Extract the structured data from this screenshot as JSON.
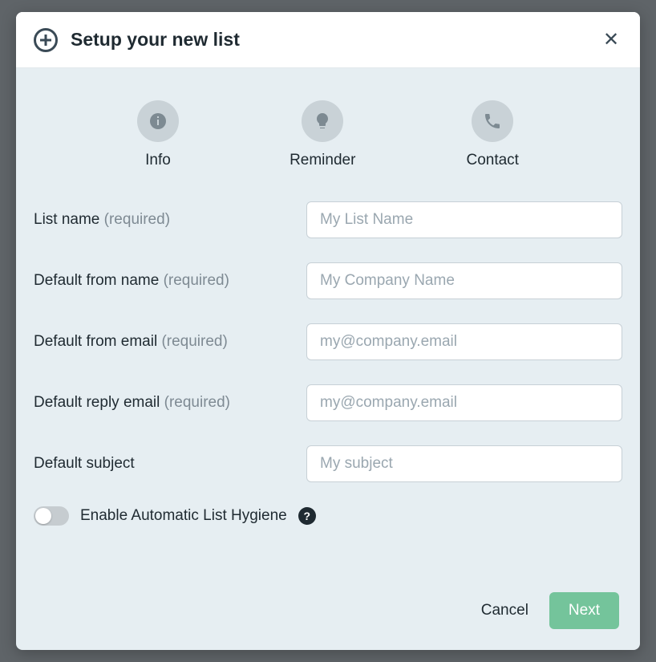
{
  "header": {
    "title": "Setup your new list"
  },
  "steps": [
    {
      "key": "info",
      "label": "Info",
      "icon": "info-icon"
    },
    {
      "key": "reminder",
      "label": "Reminder",
      "icon": "lightbulb-icon"
    },
    {
      "key": "contact",
      "label": "Contact",
      "icon": "phone-icon"
    }
  ],
  "required_suffix": "(required)",
  "fields": {
    "list_name": {
      "label": "List name",
      "required": true,
      "placeholder": "My List Name",
      "value": ""
    },
    "from_name": {
      "label": "Default from name",
      "required": true,
      "placeholder": "My Company Name",
      "value": ""
    },
    "from_email": {
      "label": "Default from email",
      "required": true,
      "placeholder": "my@company.email",
      "value": ""
    },
    "reply_email": {
      "label": "Default reply email",
      "required": true,
      "placeholder": "my@company.email",
      "value": ""
    },
    "subject": {
      "label": "Default subject",
      "required": false,
      "placeholder": "My subject",
      "value": ""
    }
  },
  "toggle": {
    "label": "Enable Automatic List Hygiene",
    "enabled": false,
    "help_char": "?"
  },
  "footer": {
    "cancel": "Cancel",
    "next": "Next"
  },
  "colors": {
    "accent": "#74c49b",
    "body_bg": "#e6eef2",
    "step_icon_bg": "#c9d2d7"
  }
}
